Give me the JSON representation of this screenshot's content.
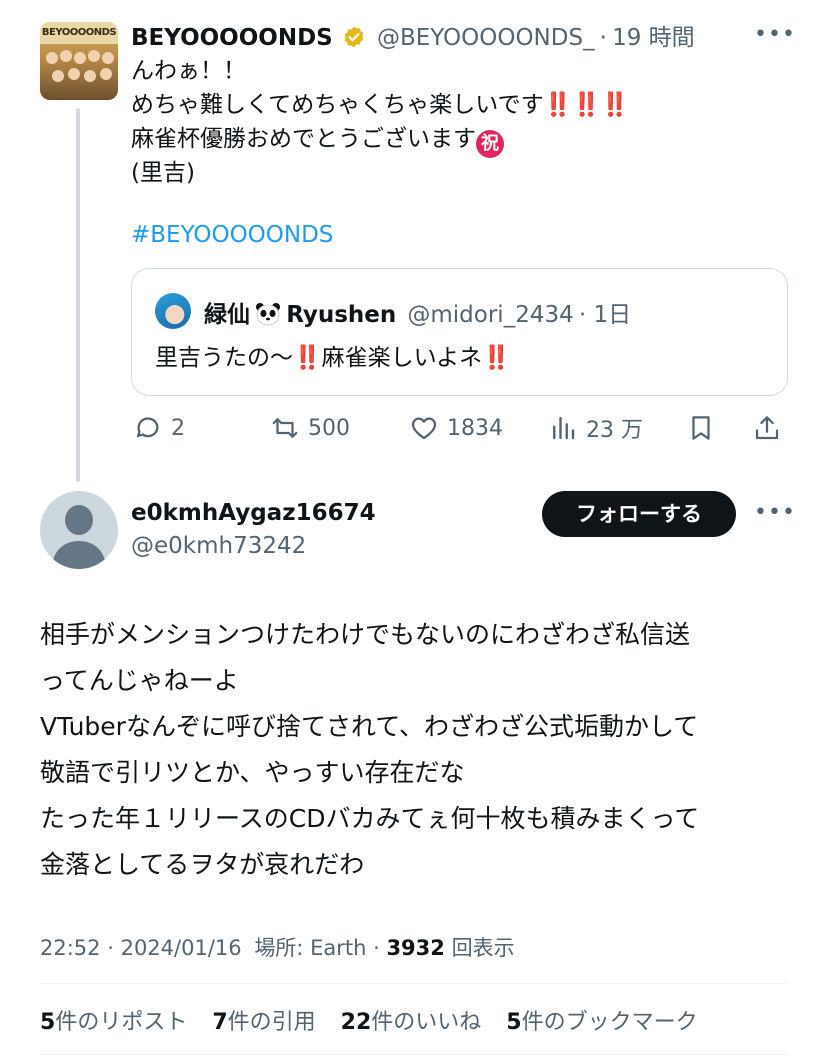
{
  "original_tweet": {
    "display_name": "BEYOOOOONDS",
    "handle": "@BEYOOOOONDS_",
    "time_sep": "·",
    "time": "19 時間",
    "more": "•••",
    "avatar_logo": "BEYOOOONDS",
    "lines": [
      "んわぁ！！",
      "めちゃ難しくてめちゃくちゃ楽しいです",
      "麻雀杯優勝おめでとうございます",
      "(里吉)"
    ],
    "bangs": "‼️‼️‼️",
    "iwai": "祝",
    "hashtag": "#BEYOOOOONDS",
    "quote": {
      "display_name_a": "緑仙",
      "display_name_b": "Ryushen",
      "handle": "@midori_2434",
      "time": "· 1日",
      "text_a": "里吉うたの〜",
      "text_b": "麻雀楽しいよネ",
      "bang": "‼️"
    },
    "actions": {
      "reply": "2",
      "retweet": "500",
      "like": "1834",
      "views": "23 万"
    }
  },
  "reply_tweet": {
    "display_name": "e0kmhAygaz16674",
    "handle": "@e0kmh73242",
    "follow_label": "フォローする",
    "more": "•••",
    "lines": [
      "相手がメンションつけたわけでもないのにわざわざ私信送",
      "ってんじゃねーよ",
      "VTuberなんぞに呼び捨てされて、わざわざ公式垢動かして",
      "敬語で引リツとか、やっすい存在だな",
      "たった年１リリースのCDバカみてぇ何十枚も積みまくって",
      "金落としてるヲタが哀れだわ"
    ],
    "meta": {
      "time": "22:52",
      "date": "2024/01/16",
      "location": "場所: Earth",
      "views_count": "3932",
      "views_label": "回表示"
    },
    "stats": [
      {
        "count": "5",
        "label": "件のリポスト"
      },
      {
        "count": "7",
        "label": "件の引用"
      },
      {
        "count": "22",
        "label": "件のいいね"
      },
      {
        "count": "5",
        "label": "件のブックマーク"
      }
    ]
  },
  "icons": [
    "reply-icon",
    "retweet-icon",
    "like-icon",
    "views-icon",
    "bookmark-icon",
    "share-icon",
    "verified-badge-icon",
    "more-icon"
  ],
  "colors": {
    "link": "#1d9bf0",
    "verified": "#e2b719",
    "text": "#0f1419",
    "muted": "#536471",
    "follow_bg": "#0f1419"
  }
}
